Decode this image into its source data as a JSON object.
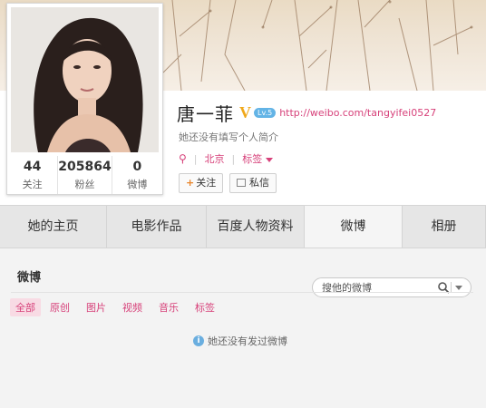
{
  "profile": {
    "name": "唐一菲",
    "verified_mark": "V",
    "badge_text": "Lv.5",
    "url": "http://weibo.com/tangyifei0527",
    "intro": "她还没有填写个人简介",
    "location": "北京",
    "tags_label": "标签",
    "follow_label": "关注",
    "message_label": "私信"
  },
  "stats": [
    {
      "value": "44",
      "label": "关注"
    },
    {
      "value": "205864",
      "label": "粉丝"
    },
    {
      "value": "0",
      "label": "微博"
    }
  ],
  "tabs": [
    {
      "label": "她的主页"
    },
    {
      "label": "电影作品"
    },
    {
      "label": "百度人物资料"
    },
    {
      "label": "微博"
    },
    {
      "label": "相册"
    }
  ],
  "feed": {
    "title": "微博",
    "search_placeholder": "搜他的微博",
    "filters": [
      "全部",
      "原创",
      "图片",
      "视频",
      "音乐",
      "标签"
    ],
    "empty_message": "她还没有发过微博"
  },
  "icons": {
    "pin": "location-pin-icon",
    "search": "search-icon",
    "info": "info-icon"
  },
  "colors": {
    "accent_pink": "#d7417a",
    "verified_gold": "#f0a81a",
    "badge_blue": "#63b4e6"
  }
}
